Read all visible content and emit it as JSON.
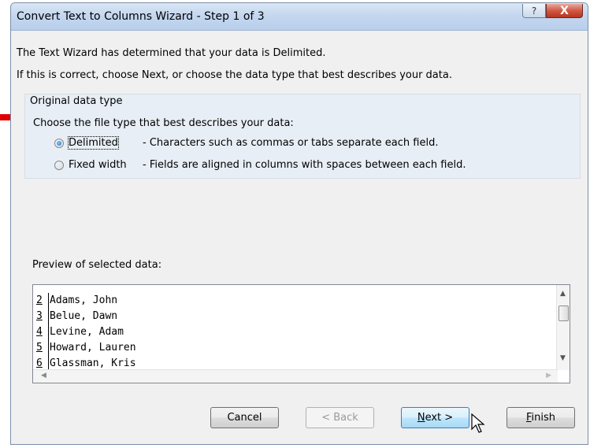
{
  "window": {
    "title": "Convert Text to Columns Wizard - Step 1 of 3",
    "help_symbol": "?",
    "close_symbol": "X"
  },
  "intro": {
    "line1": "The Text Wizard has determined that your data is Delimited.",
    "line2": "If this is correct, choose Next, or choose the data type that best describes your data."
  },
  "original_data_type": {
    "legend": "Original data type",
    "prompt": "Choose the file type that best describes your data:",
    "options": [
      {
        "label": "Delimited",
        "description": "- Characters such as commas or tabs separate each field.",
        "selected": true
      },
      {
        "label": "Fixed width",
        "description": "- Fields are aligned in columns with spaces between each field.",
        "selected": false
      }
    ]
  },
  "preview": {
    "label": "Preview of selected data:",
    "rows": [
      {
        "num": "2",
        "text": "Adams, John"
      },
      {
        "num": "3",
        "text": "Belue, Dawn"
      },
      {
        "num": "4",
        "text": "Levine, Adam"
      },
      {
        "num": "5",
        "text": "Howard, Lauren"
      },
      {
        "num": "6",
        "text": "Glassman, Kris"
      }
    ]
  },
  "buttons": {
    "cancel": "Cancel",
    "back": "< Back",
    "next_mnemonic": "N",
    "next_rest": "ext >",
    "finish_mnemonic": "F",
    "finish_rest": "inish"
  },
  "colors": {
    "accent_arrow": "#e00000",
    "title_bar": "#c3d6ee",
    "close_button": "#c94b35"
  }
}
